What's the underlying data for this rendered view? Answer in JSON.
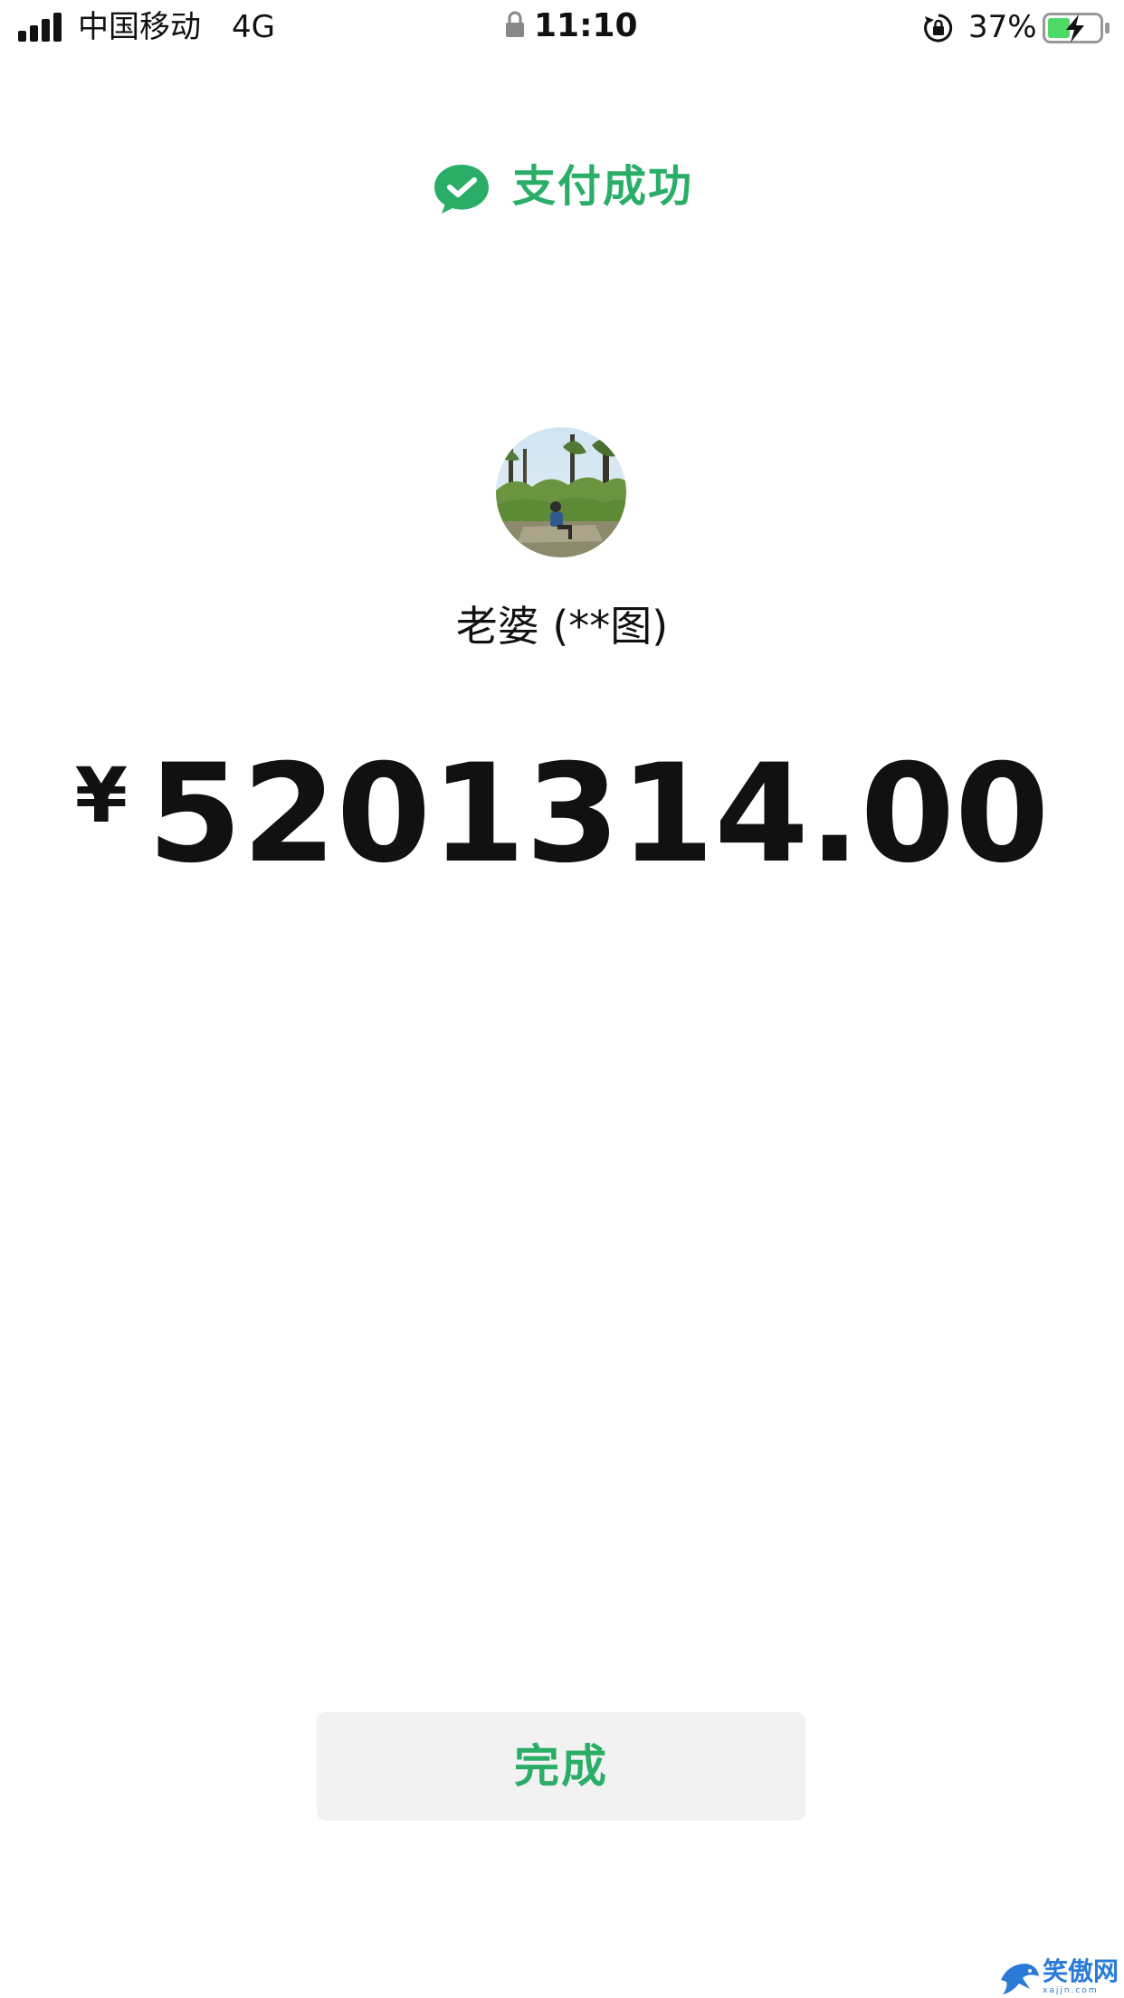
{
  "status_bar": {
    "carrier": "中国移动",
    "network": "4G",
    "time": "11:10",
    "battery_percent": "37%",
    "icons": [
      "signal-icon",
      "lock-icon",
      "rotation-lock-icon",
      "battery-charging-icon"
    ]
  },
  "header": {
    "icon": "wechat-pay-icon",
    "title": "支付成功"
  },
  "payee": {
    "avatar": "avatar-photo",
    "name": "老婆 (**图)"
  },
  "payment": {
    "currency_symbol": "¥",
    "amount": "5201314.00"
  },
  "actions": {
    "done_label": "完成"
  },
  "watermark": {
    "text": "笑傲网",
    "sub": "xajjn.com"
  },
  "colors": {
    "accent": "#2aae67",
    "button_bg": "#f2f2f2",
    "text": "#111111",
    "background": "#ffffff"
  }
}
